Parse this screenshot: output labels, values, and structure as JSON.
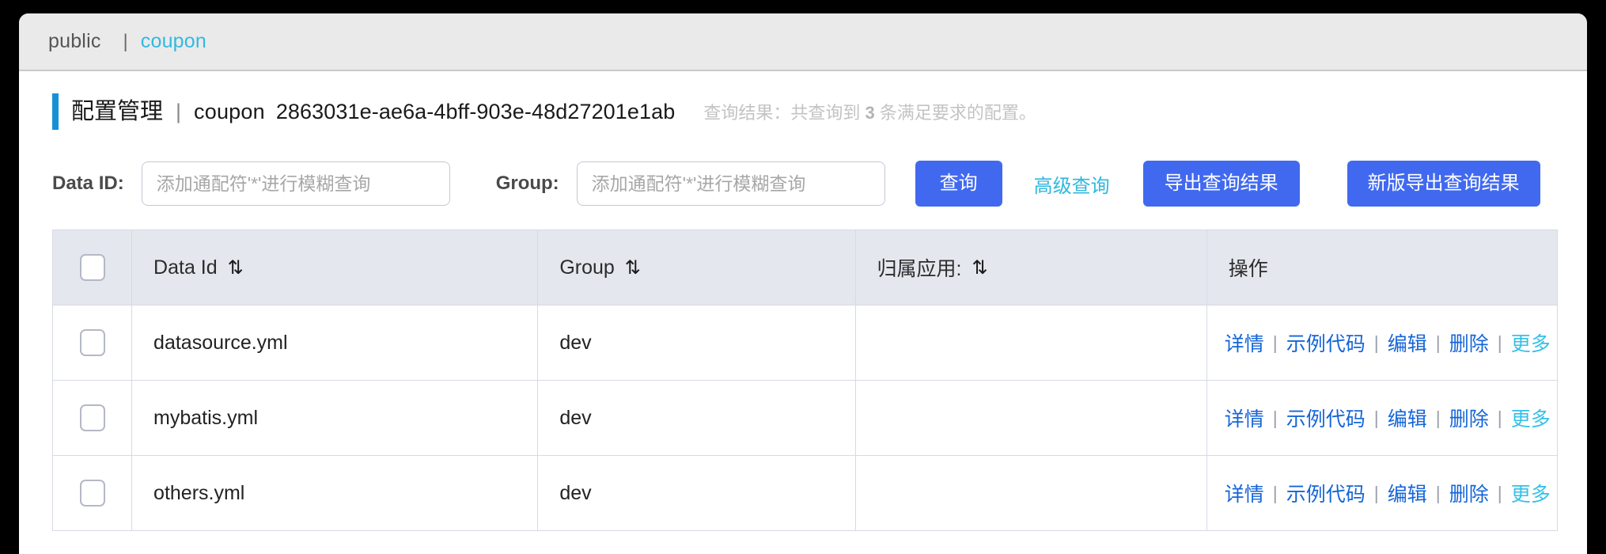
{
  "breadcrumb": {
    "root": "public",
    "separator": "|",
    "current": "coupon"
  },
  "title": {
    "main": "配置管理",
    "divider": "|",
    "scope": "coupon",
    "id": "2863031e-ae6a-4bff-903e-48d27201e1ab",
    "query_result_prefix": "查询结果：共查询到 ",
    "query_result_count": "3",
    "query_result_suffix": " 条满足要求的配置。"
  },
  "filters": {
    "data_id_label": "Data ID:",
    "data_id_value": "",
    "data_id_placeholder": "添加通配符'*'进行模糊查询",
    "group_label": "Group:",
    "group_value": "",
    "group_placeholder": "添加通配符'*'进行模糊查询",
    "search_button": "查询",
    "advanced_button": "高级查询",
    "export_button": "导出查询结果",
    "export_new_button": "新版导出查询结果"
  },
  "table": {
    "columns": [
      {
        "key": "check",
        "label": "",
        "sortable": false
      },
      {
        "key": "data_id",
        "label": "Data Id",
        "sortable": true
      },
      {
        "key": "group",
        "label": "Group",
        "sortable": true
      },
      {
        "key": "app",
        "label": "归属应用:",
        "sortable": true
      },
      {
        "key": "ops",
        "label": "操作",
        "sortable": false
      }
    ],
    "sort_icon": "⇅",
    "rows": [
      {
        "data_id": "datasource.yml",
        "group": "dev",
        "app": ""
      },
      {
        "data_id": "mybatis.yml",
        "group": "dev",
        "app": ""
      },
      {
        "data_id": "others.yml",
        "group": "dev",
        "app": ""
      }
    ],
    "operations": [
      "详情",
      "示例代码",
      "编辑",
      "删除",
      "更多"
    ],
    "operation_separator": "|"
  },
  "colors": {
    "accent_blue": "#4169f0",
    "link_blue": "#1565d8",
    "cyan": "#35c0e8",
    "title_bar": "#1890d6",
    "header_bg": "#e5e7ee",
    "breadcrumb_bg": "#eaeaea"
  }
}
